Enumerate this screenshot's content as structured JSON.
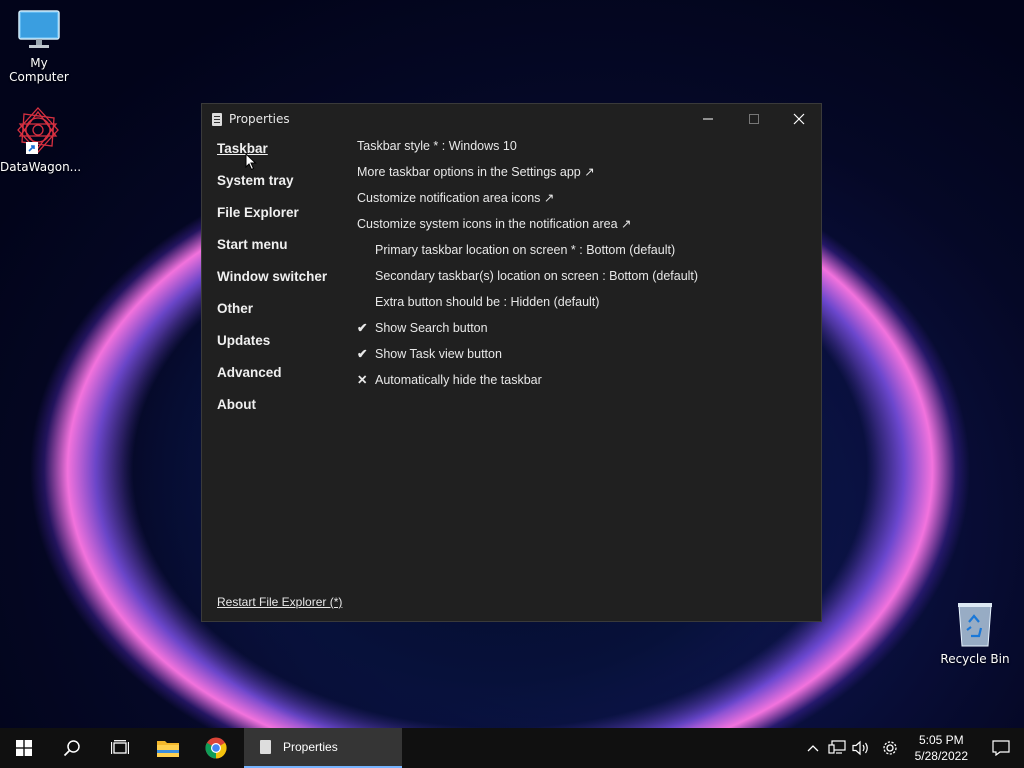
{
  "desktop": {
    "icons": [
      {
        "label": "My Computer"
      },
      {
        "label": "DataWagon..."
      },
      {
        "label": "Recycle Bin"
      }
    ]
  },
  "window": {
    "title": "Properties",
    "nav": [
      {
        "label": "Taskbar",
        "active": true
      },
      {
        "label": "System tray"
      },
      {
        "label": "File Explorer"
      },
      {
        "label": "Start menu"
      },
      {
        "label": "Window switcher"
      },
      {
        "label": "Other"
      },
      {
        "label": "Updates"
      },
      {
        "label": "Advanced"
      },
      {
        "label": "About"
      }
    ],
    "options": [
      {
        "label": "Taskbar style * : Windows 10"
      },
      {
        "label": "More taskbar options in the Settings app ↗"
      },
      {
        "label": "Customize notification area icons ↗"
      },
      {
        "label": "Customize system icons in the notification area ↗"
      },
      {
        "label": "Primary taskbar location on screen * : Bottom (default)"
      },
      {
        "label": "Secondary taskbar(s) location on screen : Bottom (default)"
      },
      {
        "label": "Extra button should be : Hidden (default)"
      },
      {
        "label": "Show Search button",
        "mark": "✔"
      },
      {
        "label": "Show Task view button",
        "mark": "✔"
      },
      {
        "label": "Automatically hide the taskbar",
        "mark": "✕"
      }
    ],
    "footer_link": "Restart File Explorer (*)"
  },
  "taskbar": {
    "active_app": "Properties",
    "time": "5:05 PM",
    "date": "5/28/2022"
  },
  "colors": {
    "window_bg": "#202020",
    "taskbar_bg": "#101010",
    "active_app_bg": "#353535",
    "accent": "#77b4ff"
  }
}
